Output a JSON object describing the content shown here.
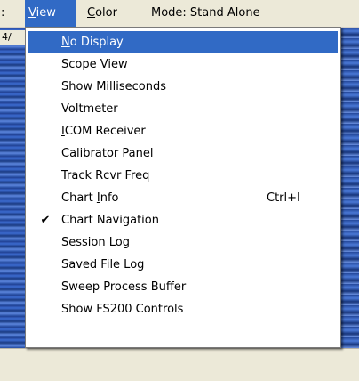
{
  "menubar": {
    "dots": ":",
    "view": {
      "pre": "",
      "mnem": "V",
      "post": "iew"
    },
    "color": {
      "pre": "",
      "mnem": "C",
      "post": "olor"
    },
    "mode": "Mode: Stand Alone"
  },
  "background": {
    "left_fragment": "4/"
  },
  "view_menu": {
    "items": [
      {
        "pre": "",
        "mnem": "N",
        "post": "o Display",
        "selected": true,
        "checked": false,
        "shortcut": ""
      },
      {
        "pre": "Sco",
        "mnem": "p",
        "post": "e View",
        "selected": false,
        "checked": false,
        "shortcut": ""
      },
      {
        "pre": "Show Milliseconds",
        "mnem": "",
        "post": "",
        "selected": false,
        "checked": false,
        "shortcut": ""
      },
      {
        "pre": "Voltmeter",
        "mnem": "",
        "post": "",
        "selected": false,
        "checked": false,
        "shortcut": ""
      },
      {
        "pre": "",
        "mnem": "I",
        "post": "COM Receiver",
        "selected": false,
        "checked": false,
        "shortcut": ""
      },
      {
        "pre": "Cali",
        "mnem": "b",
        "post": "rator Panel",
        "selected": false,
        "checked": false,
        "shortcut": ""
      },
      {
        "pre": "Track Rcvr Freq",
        "mnem": "",
        "post": "",
        "selected": false,
        "checked": false,
        "shortcut": ""
      },
      {
        "pre": "Chart ",
        "mnem": "I",
        "post": "nfo",
        "selected": false,
        "checked": false,
        "shortcut": "Ctrl+I"
      },
      {
        "pre": "Chart Navigation",
        "mnem": "",
        "post": "",
        "selected": false,
        "checked": true,
        "shortcut": ""
      },
      {
        "pre": "",
        "mnem": "S",
        "post": "ession Log",
        "selected": false,
        "checked": false,
        "shortcut": ""
      },
      {
        "pre": "Saved File Log",
        "mnem": "",
        "post": "",
        "selected": false,
        "checked": false,
        "shortcut": ""
      },
      {
        "pre": "Sweep Process Buffer",
        "mnem": "",
        "post": "",
        "selected": false,
        "checked": false,
        "shortcut": ""
      },
      {
        "pre": "Show FS200 Controls",
        "mnem": "",
        "post": "",
        "selected": false,
        "checked": false,
        "shortcut": ""
      }
    ],
    "check_glyph": "✔"
  }
}
